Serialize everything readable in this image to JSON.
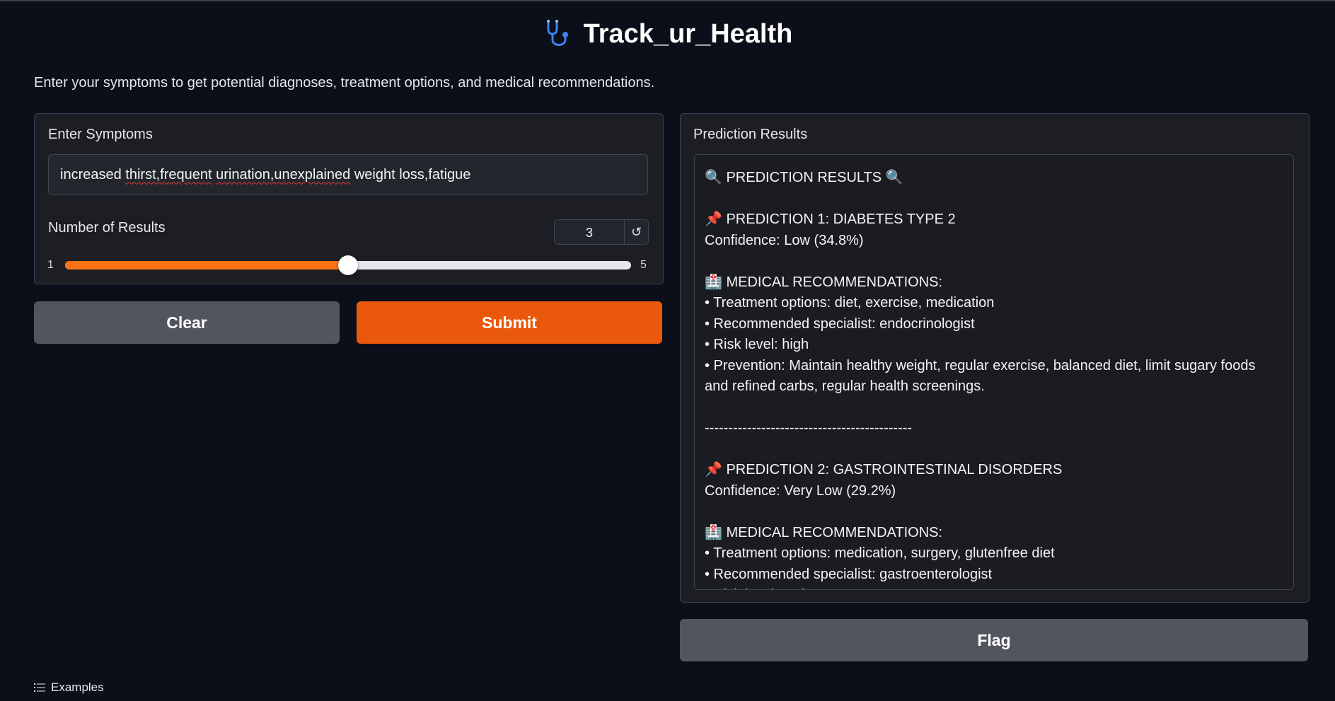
{
  "app": {
    "title": "Track_ur_Health",
    "description": "Enter your symptoms to get potential diagnoses, treatment options, and medical recommendations."
  },
  "input_panel": {
    "symptoms_label": "Enter Symptoms",
    "symptoms_value": {
      "plain1": "increased ",
      "err1": "thirst,frequent",
      "plain2": " ",
      "err2": "urination,unexplained",
      "plain3": " weight loss,fatigue"
    },
    "results_count_label": "Number of Results",
    "results_count_value": "3",
    "slider": {
      "min": "1",
      "max": "5",
      "value": 3
    },
    "reset_icon": "reset-icon",
    "reset_glyph": "↺"
  },
  "buttons": {
    "clear": "Clear",
    "submit": "Submit",
    "flag": "Flag"
  },
  "output_panel": {
    "label": "Prediction Results",
    "lines": [
      "🔍 PREDICTION RESULTS 🔍",
      "",
      "📌 PREDICTION 1: DIABETES TYPE 2",
      "Confidence: Low (34.8%)",
      "",
      "🏥 MEDICAL RECOMMENDATIONS:",
      "• Treatment options: diet, exercise, medication",
      "• Recommended specialist: endocrinologist",
      "• Risk level: high",
      "• Prevention: Maintain healthy weight, regular exercise, balanced diet, limit sugary foods and refined carbs, regular health screenings.",
      "",
      "--------------------------------------------",
      "",
      "📌 PREDICTION 2: GASTROINTESTINAL DISORDERS",
      "Confidence: Very Low (29.2%)",
      "",
      "🏥 MEDICAL RECOMMENDATIONS:",
      "• Treatment options: medication, surgery, glutenfree diet",
      "• Recommended specialist: gastroenterologist",
      "• Risk level: varies"
    ]
  },
  "footer": {
    "examples_label": "Examples",
    "examples_icon": "list-icon"
  },
  "colors": {
    "background": "#0b0f19",
    "accent": "#ea580c",
    "slider_fill": "#f97316",
    "secondary_button": "#52555e",
    "logo": "#3b82f6"
  },
  "icons": {
    "logo": "stethoscope-icon"
  }
}
